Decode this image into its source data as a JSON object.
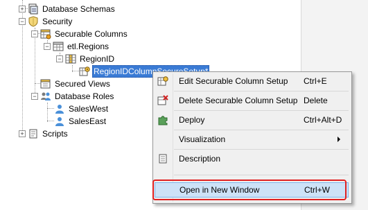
{
  "tree": {
    "database_schemas": "Database Schemas",
    "security": "Security",
    "securable_columns": "Securable Columns",
    "etl_regions": "etl.Regions",
    "region_id": "RegionID",
    "selected_setup": "RegionIDColumnSecureSetup*",
    "secured_views": "Secured Views",
    "database_roles": "Database Roles",
    "sales_west": "SalesWest",
    "sales_east": "SalesEast",
    "scripts": "Scripts"
  },
  "context_menu": {
    "items": [
      {
        "label": "Edit Securable Column Setup",
        "shortcut": "Ctrl+E",
        "icon": "edit-setup-icon"
      },
      {
        "label": "Delete Securable Column Setup",
        "shortcut": "Delete",
        "icon": "delete-setup-icon"
      },
      {
        "label": "Deploy",
        "shortcut": "Ctrl+Alt+D",
        "icon": "puzzle-deploy-icon"
      },
      {
        "label": "Visualization",
        "shortcut": "",
        "icon": ""
      },
      {
        "label": "Description",
        "shortcut": "",
        "icon": "document-icon"
      },
      {
        "label": "Open in New Window",
        "shortcut": "Ctrl+W",
        "icon": ""
      }
    ]
  },
  "colors": {
    "selection": "#3a7bd5",
    "highlight_border": "#e02020",
    "menu_hover": "#cde2f7"
  }
}
